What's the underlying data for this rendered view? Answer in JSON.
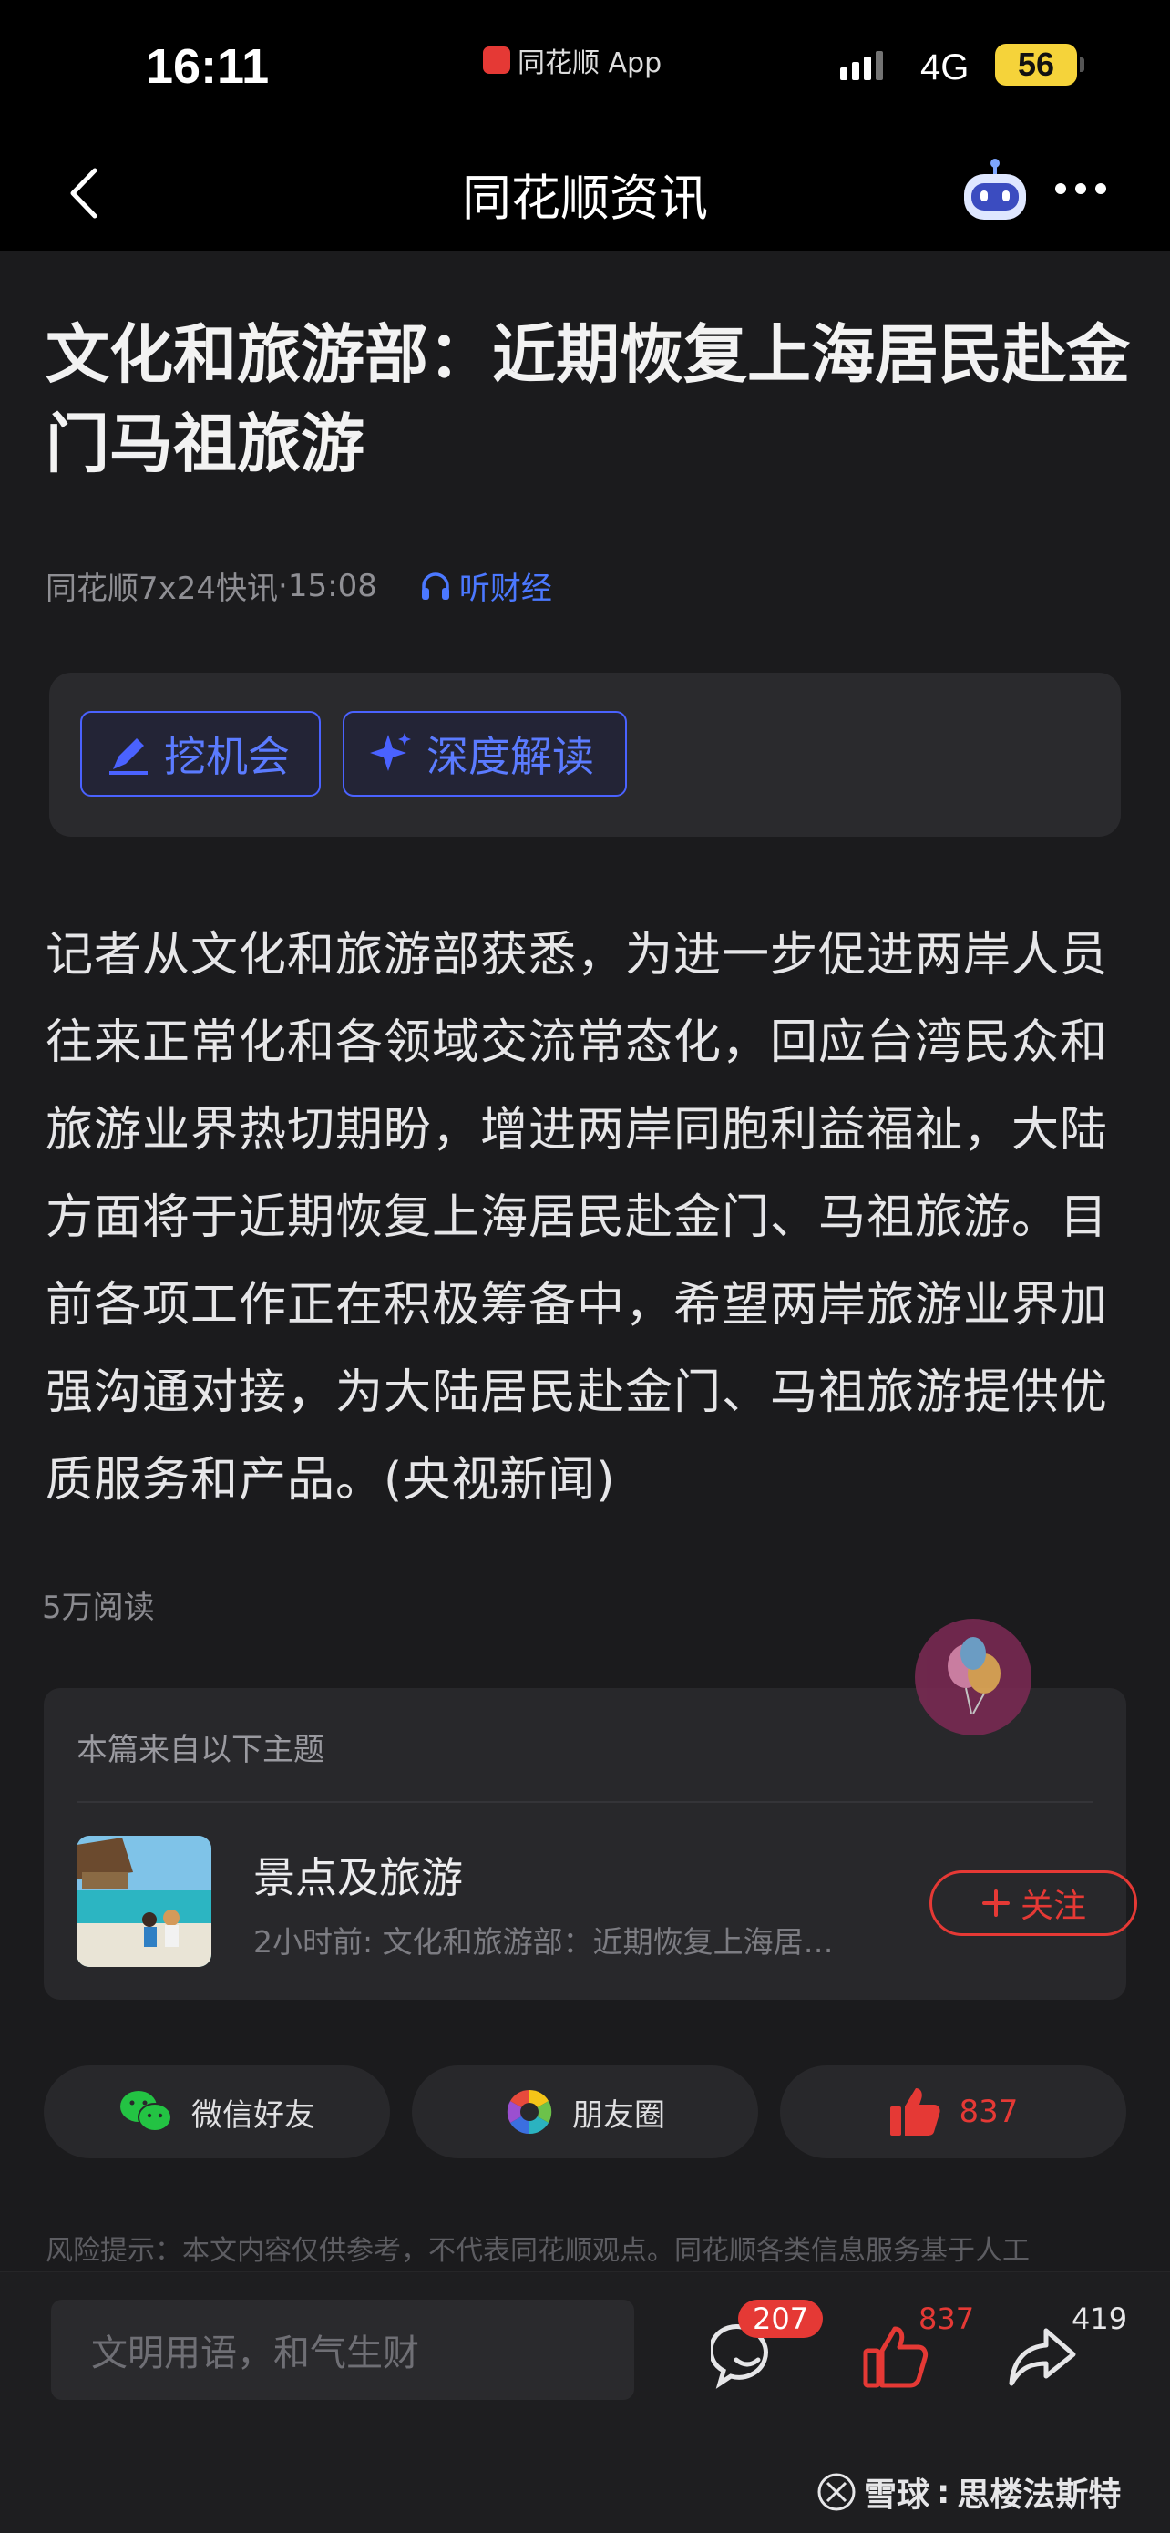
{
  "status_bar": {
    "time": "16:11",
    "app_indicator": "同花顺 App",
    "network": "4G",
    "battery": "56"
  },
  "nav": {
    "title": "同花顺资讯",
    "back_icon": "chevron-left-icon",
    "assistant_icon": "robot-icon",
    "more_icon": "more-dots-icon"
  },
  "article": {
    "headline": "文化和旅游部：近期恢复上海居民赴金门马祖旅游",
    "source": "同花顺7x24快讯",
    "time": "15:08",
    "listen_label": "听财经",
    "ai_buttons": [
      {
        "label": "挖机会",
        "icon": "pen-icon"
      },
      {
        "label": "深度解读",
        "icon": "sparkle-icon"
      }
    ],
    "body": "记者从文化和旅游部获悉，为进一步促进两岸人员往来正常化和各领域交流常态化，回应台湾民众和旅游业界热切期盼，增进两岸同胞利益福祉，大陆方面将于近期恢复上海居民赴金门、马祖旅游。目前各项工作正在积极筹备中，希望两岸旅游业界加强沟通对接，为大陆居民赴金门、马祖旅游提供优质服务和产品。(央视新闻)",
    "reads": "5万阅读"
  },
  "topic": {
    "header": "本篇来自以下主题",
    "name": "景点及旅游",
    "subtitle": "2小时前: 文化和旅游部：近期恢复上海居…",
    "follow_label": "关注"
  },
  "share": {
    "wechat": "微信好友",
    "moments": "朋友圈",
    "likes": "837"
  },
  "risk_notice": "风险提示：本文内容仅供参考，不代表同花顺观点。同花顺各类信息服务基于人工",
  "bottom_bar": {
    "comment_placeholder": "文明用语，和气生财",
    "comment_count": "207",
    "like_count": "837",
    "share_count": "419"
  },
  "watermark": {
    "brand": "雪球",
    "author": "思楼法斯特"
  },
  "colors": {
    "accent_red": "#e53935",
    "accent_blue": "#4b78ff",
    "background": "#1b1b1d"
  }
}
